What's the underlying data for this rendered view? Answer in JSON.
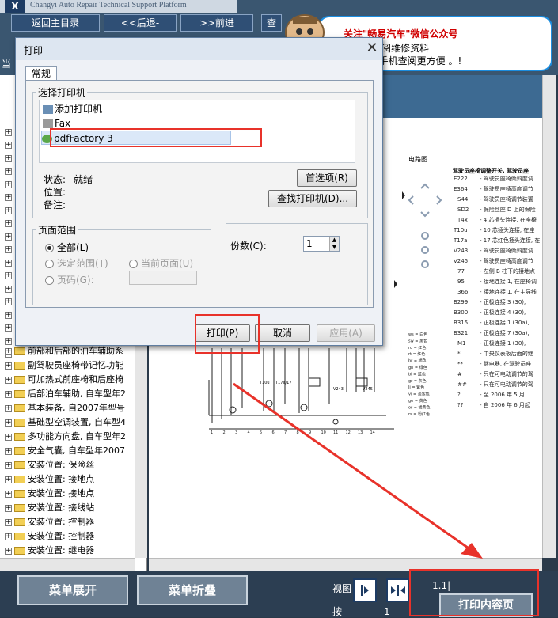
{
  "header": {
    "brand": "Changyi Auto Repair Technical Support Platform",
    "nav": {
      "home": "返回主目录",
      "back": "<<后退-",
      "forward": ">>前进",
      "partial": "查"
    }
  },
  "ad": {
    "line1": "关注\"畅易汽车\"微信公众号",
    "line2": "用手机查阅维修资料",
    "line3": "打印啦! 手机查阅更方便 。!"
  },
  "left": {
    "top_partial": "当",
    "tree_items": [
      "前部和后部的泊车辅助系",
      "副驾驶员座椅带记忆功能",
      "可加热式前座椅和后座椅",
      "后部泊车辅助, 自车型年2",
      "基本装备, 自2007年型号",
      "基础型空调装置, 自车型4",
      "多功能方向盘, 自车型年2",
      "安全气囊, 自车型年2007",
      "安装位置: 保险丝",
      "安装位置: 接地点",
      "安装位置: 接地点",
      "安装位置: 接线站",
      "安装位置: 控制器",
      "安装位置: 控制器",
      "安装位置: 继电器"
    ]
  },
  "doc": {
    "section_label": "电路图",
    "title_text": "驾驶员座椅调整开关, 驾驶员座",
    "codes": [
      [
        "E222",
        "驾驶员座椅倾斜度调"
      ],
      [
        "E364",
        "驾驶员座椅高度调节"
      ],
      [
        "S44",
        "驾驶员座椅调节装置"
      ],
      [
        "SD2",
        "保险丝座 D 上的保险"
      ],
      [
        "T4x",
        "4 芯插头连接, 在座椅"
      ],
      [
        "T10u",
        "10 芯插头连接, 在座"
      ],
      [
        "T17a",
        "17 芯红色插头连接, 在"
      ],
      [
        "V243",
        "驾驶员座椅倾斜度调"
      ],
      [
        "V245",
        "驾驶员座椅高度调节"
      ],
      [
        "77",
        "左侧 B 柱下的接地点"
      ],
      [
        "95",
        "接地连接 1, 在座椅调"
      ],
      [
        "366",
        "接地连接 1, 在主导线"
      ],
      [
        "B299",
        "正极连接 3 (30),"
      ],
      [
        "B300",
        "正极连接 4 (30),"
      ],
      [
        "B315",
        "正极连接 1 (30a),"
      ],
      [
        "B321",
        "正极连接 7 (30a),"
      ],
      [
        "M1",
        "正极连接 1 (30),"
      ],
      [
        "*",
        "中央仪表板后面的继"
      ],
      [
        "**",
        "继电器, 在驾驶员座"
      ],
      [
        "#",
        "只在可电动调节的驾"
      ],
      [
        "##",
        "只在可电动调节的驾"
      ],
      [
        "?",
        "至 2006 年 5 月"
      ],
      [
        "??",
        "自 2006 年 6 月起"
      ]
    ],
    "colors_legend": [
      "ws = 白色",
      "sw = 黑色",
      "ro = 红色",
      "rt = 红色",
      "br = 褐色",
      "gn = 绿色",
      "bl = 蓝色",
      "gr = 灰色",
      "li = 紫色",
      "vi = 淡紫色",
      "ge = 黄色",
      "or = 橘黄色",
      "rs = 粉红色"
    ],
    "ruler": [
      "1",
      "2",
      "3",
      "4",
      "5",
      "6",
      "7",
      "8",
      "9",
      "10",
      "11",
      "12",
      "13",
      "14"
    ],
    "small_labels": {
      "connector1": "T10u",
      "connector2": "T17a/17",
      "v1": "V243",
      "v2": "V245"
    }
  },
  "bottom": {
    "expand": "菜单展开",
    "collapse": "菜单折叠",
    "view_partial": "视图",
    "small_partial": "按",
    "page_indicator": "1.1|",
    "page_num": "1",
    "print_content": "打印内容页"
  },
  "dialog": {
    "title": "打印",
    "tab_general": "常规",
    "select_printer": "选择打印机",
    "printers": [
      "添加打印机",
      "Fax",
      "pdfFactory 3"
    ],
    "selected_printer_index": 2,
    "status_label": "状态:",
    "status_value": "就绪",
    "location_label": "位置:",
    "comment_label": "备注:",
    "preferences_btn": "首选项(R)",
    "find_printer_btn": "查找打印机(D)...",
    "page_range": "页面范围",
    "range_all": "全部(L)",
    "range_selection": "选定范围(T)",
    "range_current": "当前页面(U)",
    "range_pages": "页码(G):",
    "copies_label": "份数(C):",
    "copies_value": "1",
    "print_btn": "打印(P)",
    "cancel_btn": "取消",
    "apply_btn": "应用(A)"
  },
  "colors": {
    "highlight": "#e8322a",
    "ad_border": "#1a8de0",
    "bg_dark": "#2c3e52"
  }
}
